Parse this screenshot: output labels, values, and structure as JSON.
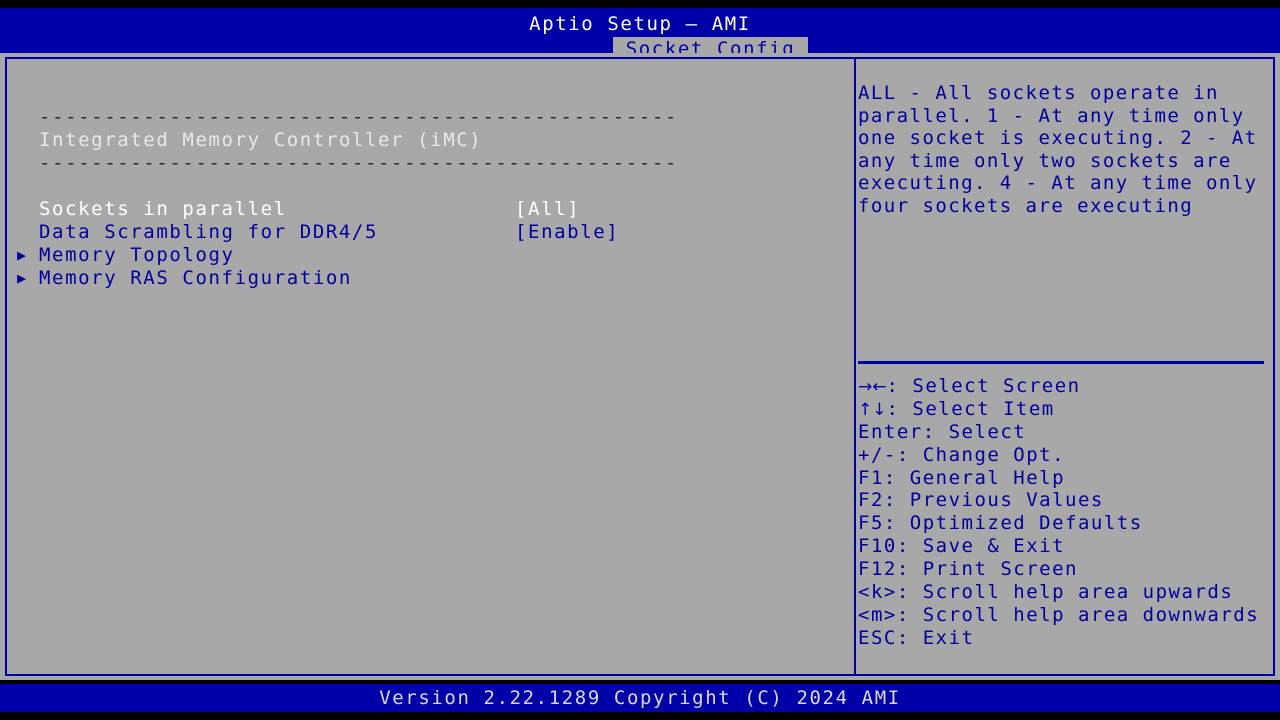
{
  "header": {
    "title": "Aptio Setup – AMI",
    "active_tab": "Socket Config"
  },
  "main": {
    "separator_top": "-------------------------------------------------",
    "section_title": "Integrated Memory Controller (iMC)",
    "separator_bottom": "-------------------------------------------------",
    "items": [
      {
        "label": "Sockets in parallel",
        "value": "[All]",
        "type": "option",
        "selected": true,
        "has_submenu": false
      },
      {
        "label": "Data Scrambling for DDR4/5",
        "value": "[Enable]",
        "type": "option",
        "selected": false,
        "has_submenu": false
      },
      {
        "label": "Memory Topology",
        "value": "",
        "type": "submenu",
        "selected": false,
        "has_submenu": true
      },
      {
        "label": "Memory RAS Configuration",
        "value": "",
        "type": "submenu",
        "selected": false,
        "has_submenu": true
      }
    ],
    "submenu_arrow": "▶"
  },
  "help": {
    "text": "ALL - All sockets operate in parallel. 1 - At any time only one socket is executing. 2 - At any time only two sockets are executing. 4 - At any time only four sockets are executing"
  },
  "keys": [
    {
      "glyph": "→←",
      "key": "",
      "sep": ": ",
      "action": "Select Screen"
    },
    {
      "glyph": "↑↓",
      "key": "",
      "sep": ": ",
      "action": "Select Item"
    },
    {
      "glyph": "",
      "key": "Enter",
      "sep": ": ",
      "action": "Select"
    },
    {
      "glyph": "",
      "key": "+/-",
      "sep": ": ",
      "action": "Change Opt."
    },
    {
      "glyph": "",
      "key": "F1",
      "sep": ": ",
      "action": "General Help"
    },
    {
      "glyph": "",
      "key": "F2",
      "sep": ": ",
      "action": "Previous Values"
    },
    {
      "glyph": "",
      "key": "F5",
      "sep": ": ",
      "action": "Optimized Defaults"
    },
    {
      "glyph": "",
      "key": "F10",
      "sep": ": ",
      "action": "Save & Exit"
    },
    {
      "glyph": "",
      "key": "F12",
      "sep": ": ",
      "action": "Print Screen"
    },
    {
      "glyph": "",
      "key": "<k>",
      "sep": ": ",
      "action": "Scroll help area upwards"
    },
    {
      "glyph": "",
      "key": "<m>",
      "sep": ": ",
      "action": "Scroll help area downwards"
    },
    {
      "glyph": "",
      "key": "ESC",
      "sep": ": ",
      "action": "Exit"
    }
  ],
  "footer": {
    "version_text": "Version 2.22.1289 Copyright (C) 2024 AMI"
  },
  "colors": {
    "blue_bg": "#0000a8",
    "panel_gray": "#a8a8a8",
    "text_blue": "#00009c",
    "text_white": "#ffffff",
    "dash_dark": "#2b2b2b"
  }
}
